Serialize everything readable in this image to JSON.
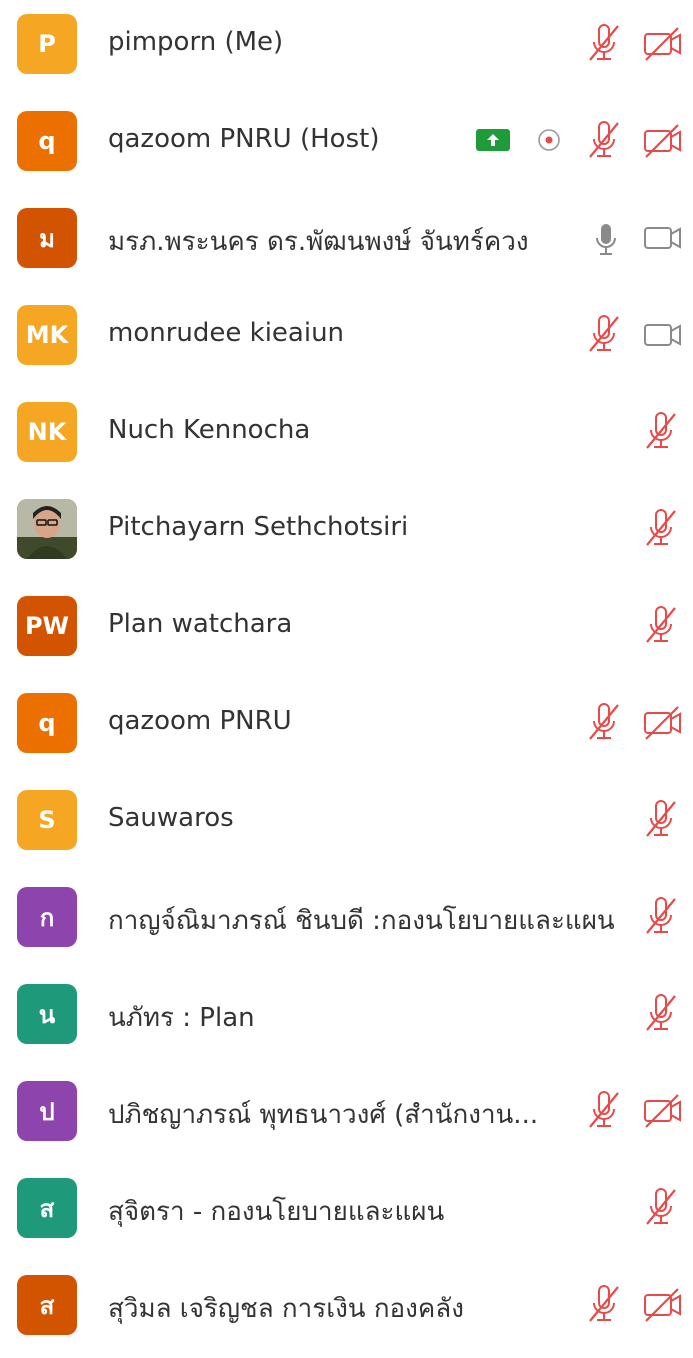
{
  "colors": {
    "orange": "#f5a623",
    "deep_orange": "#ec7000",
    "burnt_orange": "#d35400",
    "purple": "#8e44ad",
    "teal": "#1e9a7a",
    "mute_red": "#e84a4a",
    "icon_gray": "#8a8a8a",
    "upload_green": "#1f9b3a"
  },
  "participants": [
    {
      "initials": "P",
      "name": "pimporn (Me)",
      "avatar_color": "#f5a623",
      "mic": "muted",
      "video": "off"
    },
    {
      "initials": "q",
      "name": "qazoom PNRU (Host)",
      "avatar_color": "#ec7000",
      "mic": "muted",
      "video": "off",
      "upload_icon": "upload-icon",
      "record_icon": "recording-icon"
    },
    {
      "initials": "ม",
      "name": "มรภ.พระนคร ดร.พัฒนพงษ์ จันทร์ควง",
      "avatar_color": "#d35400",
      "mic": "on",
      "video": "on"
    },
    {
      "initials": "MK",
      "name": "monrudee  kieaiun",
      "avatar_color": "#f5a623",
      "mic": "muted",
      "video": "on"
    },
    {
      "initials": "NK",
      "name": "Nuch Kennocha",
      "avatar_color": "#f5a623",
      "mic": "muted",
      "video": "none"
    },
    {
      "initials": "",
      "name": "Pitchayarn Sethchotsiri",
      "avatar_color": "#8a8f7a",
      "photo": true,
      "mic": "muted",
      "video": "none"
    },
    {
      "initials": "PW",
      "name": "Plan watchara",
      "avatar_color": "#d35400",
      "mic": "muted",
      "video": "none"
    },
    {
      "initials": "q",
      "name": "qazoom PNRU",
      "avatar_color": "#ec7000",
      "mic": "muted",
      "video": "off"
    },
    {
      "initials": "S",
      "name": "Sauwaros",
      "avatar_color": "#f5a623",
      "mic": "muted",
      "video": "none"
    },
    {
      "initials": "ก",
      "name": "กาญจ์ณิมาภรณ์ ชินบดี :กองนโยบายและแผน",
      "avatar_color": "#8e44ad",
      "mic": "muted",
      "video": "none"
    },
    {
      "initials": "น",
      "name": "นภัทร : Plan",
      "avatar_color": "#1e9a7a",
      "mic": "muted",
      "video": "none"
    },
    {
      "initials": "ป",
      "name": "ปภิชญาภรณ์  พุทธนาวงศ์ (สำนักงาน...",
      "avatar_color": "#8e44ad",
      "mic": "muted",
      "video": "off"
    },
    {
      "initials": "ส",
      "name": "สุจิตรา - กองนโยบายและแผน",
      "avatar_color": "#1e9a7a",
      "mic": "muted",
      "video": "none"
    },
    {
      "initials": "ส",
      "name": "สุวิมล เจริญชล การเงิน กองคลัง",
      "avatar_color": "#d35400",
      "mic": "muted",
      "video": "off"
    }
  ]
}
